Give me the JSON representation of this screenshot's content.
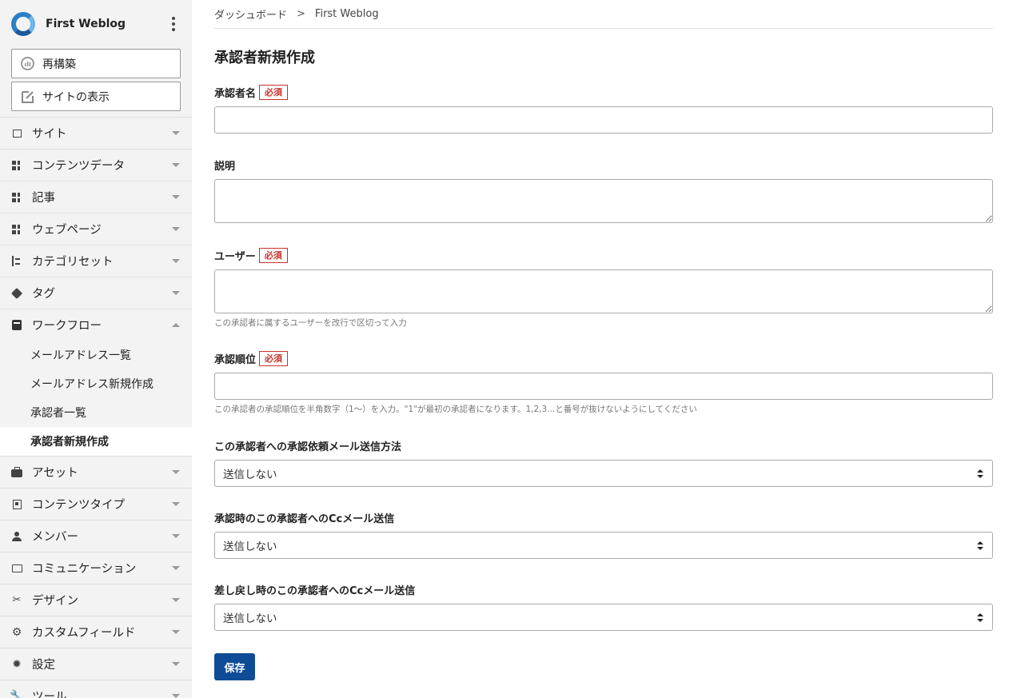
{
  "sidebar": {
    "site_name": "First Weblog",
    "buttons": {
      "rebuild": "再構築",
      "view_site": "サイトの表示"
    },
    "menu": [
      {
        "label": "サイト",
        "icon": "site-icon"
      },
      {
        "label": "コンテンツデータ",
        "icon": "content-data-icon"
      },
      {
        "label": "記事",
        "icon": "entry-icon"
      },
      {
        "label": "ウェブページ",
        "icon": "page-icon"
      },
      {
        "label": "カテゴリセット",
        "icon": "category-set-icon"
      },
      {
        "label": "タグ",
        "icon": "tag-icon"
      },
      {
        "label": "ワークフロー",
        "icon": "workflow-icon"
      },
      {
        "label": "アセット",
        "icon": "asset-icon"
      },
      {
        "label": "コンテンツタイプ",
        "icon": "content-type-icon"
      },
      {
        "label": "メンバー",
        "icon": "member-icon"
      },
      {
        "label": "コミュニケーション",
        "icon": "communication-icon"
      },
      {
        "label": "デザイン",
        "icon": "design-icon"
      },
      {
        "label": "カスタムフィールド",
        "icon": "custom-field-icon"
      },
      {
        "label": "設定",
        "icon": "gear-icon"
      },
      {
        "label": "ツール",
        "icon": "wrench-icon"
      }
    ],
    "workflow_submenu": [
      {
        "label": "メールアドレス一覧"
      },
      {
        "label": "メールアドレス新規作成"
      },
      {
        "label": "承認者一覧"
      },
      {
        "label": "承認者新規作成"
      }
    ]
  },
  "breadcrumb": {
    "dashboard": "ダッシュボード",
    "separator": ">",
    "current": "First Weblog"
  },
  "page": {
    "title": "承認者新規作成",
    "required_badge": "必須",
    "fields": {
      "name": {
        "label": "承認者名",
        "value": ""
      },
      "description": {
        "label": "説明",
        "value": ""
      },
      "users": {
        "label": "ユーザー",
        "value": "",
        "hint": "この承認者に属するユーザーを改行で区切って入力"
      },
      "order": {
        "label": "承認順位",
        "value": "",
        "hint": "この承認者の承認順位を半角数字（1～）を入力。\"1\"が最初の承認者になります。1,2,3...と番号が抜けないようにしてください"
      },
      "request_mail": {
        "label": "この承認者への承認依頼メール送信方法",
        "value": "送信しない"
      },
      "approve_cc": {
        "label": "承認時のこの承認者へのCcメール送信",
        "value": "送信しない"
      },
      "reject_cc": {
        "label": "差し戻し時のこの承認者へのCcメール送信",
        "value": "送信しない"
      }
    },
    "save_label": "保存"
  },
  "colors": {
    "primary": "#0e4c96",
    "required": "#c8332b",
    "sidebar_bg": "#f3f3f3"
  }
}
